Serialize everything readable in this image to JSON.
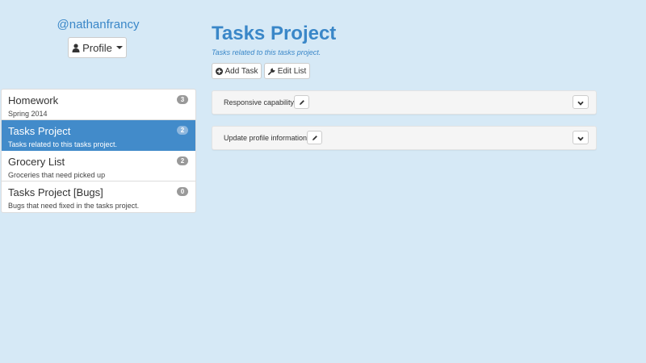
{
  "user": {
    "handle": "@nathanfrancy",
    "profile_label": "Profile"
  },
  "lists": [
    {
      "title": "Homework",
      "subtitle": "Spring 2014",
      "count": "3",
      "active": false
    },
    {
      "title": "Tasks Project",
      "subtitle": "Tasks related to this tasks project.",
      "count": "2",
      "active": true
    },
    {
      "title": "Grocery List",
      "subtitle": "Groceries that need picked up",
      "count": "2",
      "active": false
    },
    {
      "title": "Tasks Project [Bugs]",
      "subtitle": "Bugs that need fixed in the tasks project.",
      "count": "0",
      "active": false
    }
  ],
  "main": {
    "title": "Tasks Project",
    "subtitle": "Tasks related to this tasks project.",
    "add_task_label": "Add Task",
    "edit_list_label": "Edit List"
  },
  "tasks": [
    {
      "label": "Responsive capability"
    },
    {
      "label": "Update profile information"
    }
  ],
  "icons": {
    "profile": "user-icon",
    "add": "plus-circle-icon",
    "edit": "wrench-icon",
    "task_edit": "pencil-icon",
    "task_expand": "chevron-down-icon"
  },
  "colors": {
    "background": "#d6e9f6",
    "accent": "#3a87c8",
    "active_item": "#428bca",
    "badge": "#999999"
  }
}
